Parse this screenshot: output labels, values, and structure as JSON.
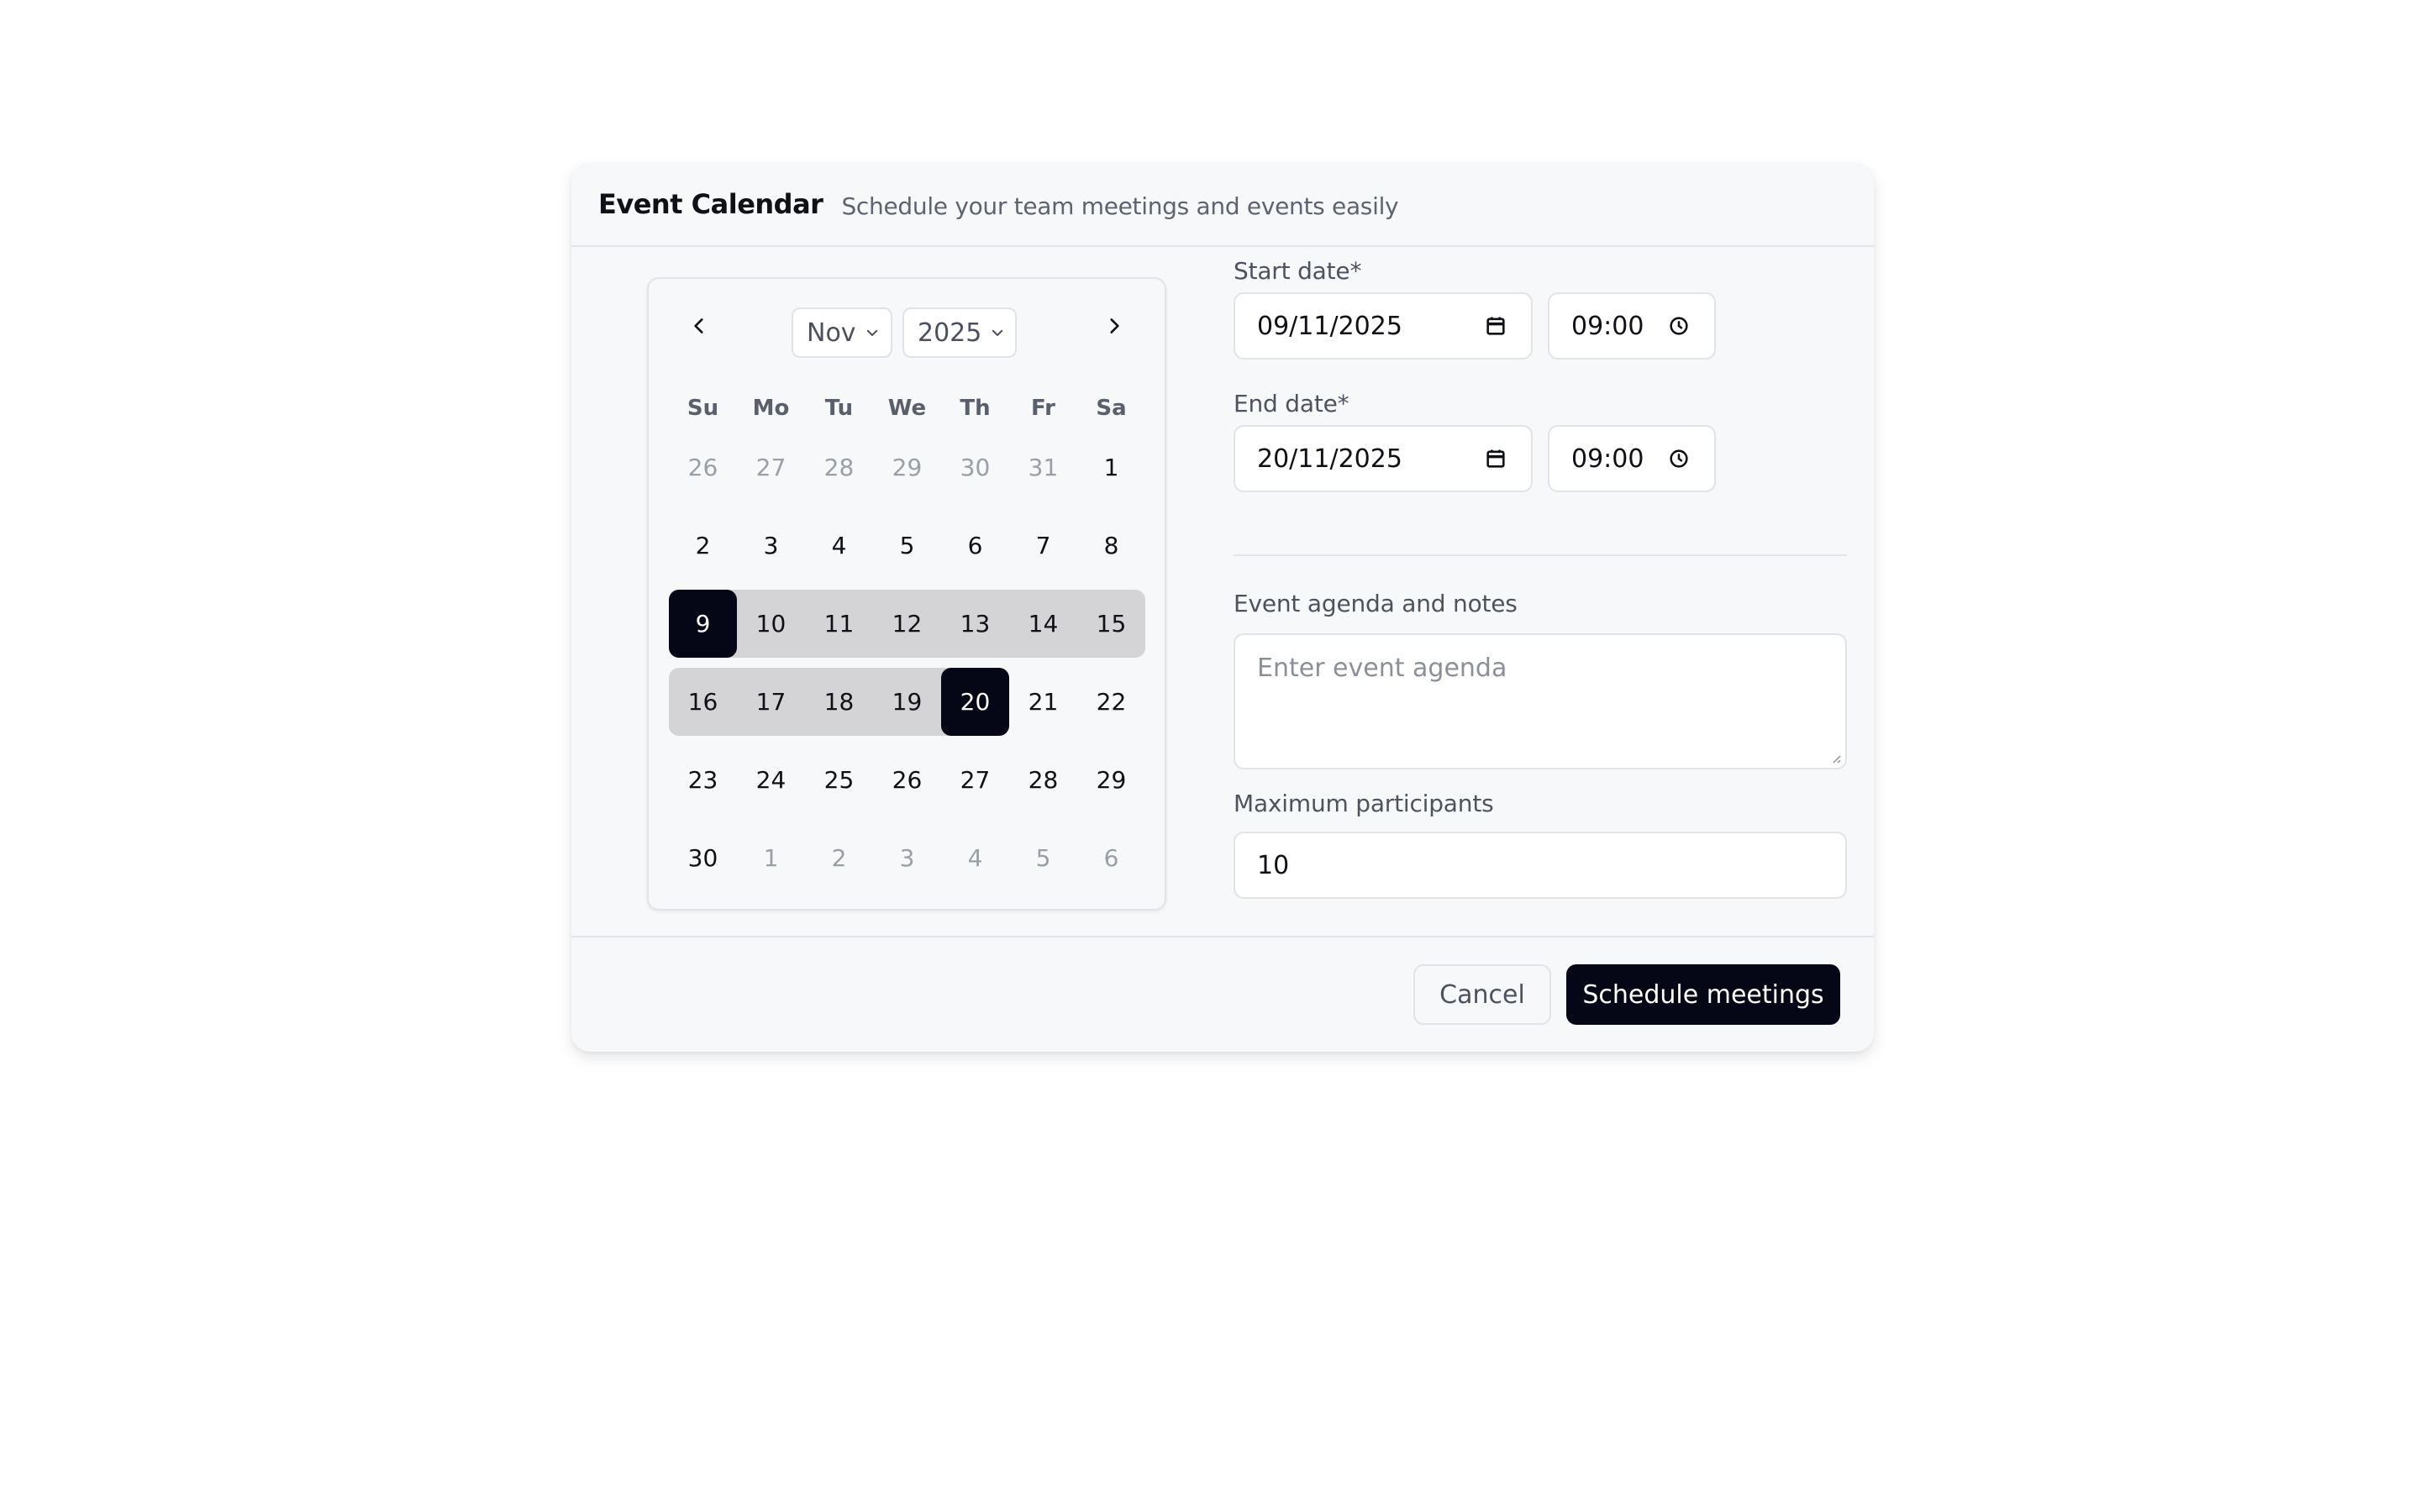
{
  "header": {
    "title": "Event Calendar",
    "subtitle": "Schedule your team meetings and events easily"
  },
  "calendar": {
    "month": "Nov",
    "year": "2025",
    "weekdays": [
      "Su",
      "Mo",
      "Tu",
      "We",
      "Th",
      "Fr",
      "Sa"
    ],
    "weeks": [
      [
        {
          "d": "26",
          "o": true
        },
        {
          "d": "27",
          "o": true
        },
        {
          "d": "28",
          "o": true
        },
        {
          "d": "29",
          "o": true
        },
        {
          "d": "30",
          "o": true
        },
        {
          "d": "31",
          "o": true
        },
        {
          "d": "1"
        }
      ],
      [
        {
          "d": "2"
        },
        {
          "d": "3"
        },
        {
          "d": "4"
        },
        {
          "d": "5"
        },
        {
          "d": "6"
        },
        {
          "d": "7"
        },
        {
          "d": "8"
        }
      ],
      [
        {
          "d": "9",
          "s": true
        },
        {
          "d": "10",
          "r": true
        },
        {
          "d": "11",
          "r": true
        },
        {
          "d": "12",
          "r": true
        },
        {
          "d": "13",
          "r": true
        },
        {
          "d": "14",
          "r": true
        },
        {
          "d": "15",
          "r": true
        }
      ],
      [
        {
          "d": "16",
          "r": true
        },
        {
          "d": "17",
          "r": true
        },
        {
          "d": "18",
          "r": true
        },
        {
          "d": "19",
          "r": true
        },
        {
          "d": "20",
          "s": true
        },
        {
          "d": "21"
        },
        {
          "d": "22"
        }
      ],
      [
        {
          "d": "23"
        },
        {
          "d": "24"
        },
        {
          "d": "25"
        },
        {
          "d": "26"
        },
        {
          "d": "27"
        },
        {
          "d": "28"
        },
        {
          "d": "29"
        }
      ],
      [
        {
          "d": "30"
        },
        {
          "d": "1",
          "o": true
        },
        {
          "d": "2",
          "o": true
        },
        {
          "d": "3",
          "o": true
        },
        {
          "d": "4",
          "o": true
        },
        {
          "d": "5",
          "o": true
        },
        {
          "d": "6",
          "o": true
        }
      ]
    ]
  },
  "form": {
    "start_label": "Start date*",
    "start_date": "09/11/2025",
    "start_time": "09:00",
    "end_label": "End date*",
    "end_date": "20/11/2025",
    "end_time": "09:00",
    "agenda_label": "Event agenda and notes",
    "agenda_placeholder": "Enter event agenda",
    "participants_label": "Maximum participants",
    "participants_value": "10"
  },
  "footer": {
    "cancel_label": "Cancel",
    "submit_label": "Schedule meetings"
  }
}
